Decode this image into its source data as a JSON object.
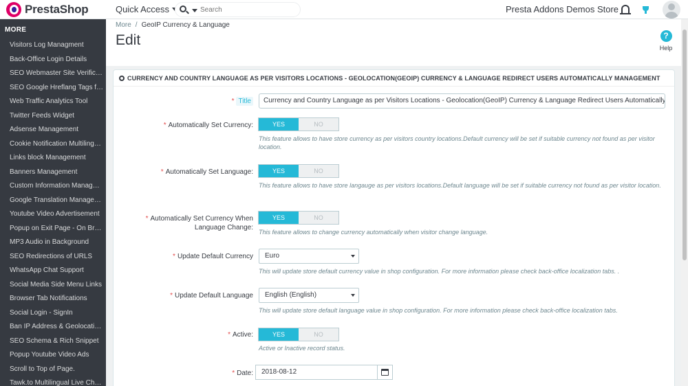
{
  "header": {
    "logo_text": "PrestaShop",
    "quick_access": "Quick Access",
    "search_placeholder": "Search",
    "store_name": "Presta Addons Demos Store"
  },
  "sidebar": {
    "heading": "MORE",
    "items": [
      "Visitors Log Managment",
      "Back-Office Login Details",
      "SEO Webmaster Site Verification",
      "SEO Google Hreflang Tags for Mul...",
      "Web Traffic Analytics Tool",
      "Twitter Feeds Widget",
      "Adsense Management",
      "Cookie Notification Multilingual",
      "Links block Management",
      "Banners Management",
      "Custom Information Managem...",
      "Google Translation Management",
      "Youtube Video Advertisement",
      "Popup on Exit Page - On Brows...",
      "MP3 Audio in Background",
      "SEO Redirections of URLS",
      "WhatsApp Chat Support",
      "Social Media Side Menu Links",
      "Browser Tab Notifications",
      "Social Login - SignIn",
      "Ban IP Address & Geolocation R...",
      "SEO Schema & Rich Snippet",
      "Popup Youtube Video Ads",
      "Scroll to Top of Page.",
      "Tawk.to Multilingual Live Chat S..."
    ]
  },
  "pagehead": {
    "breadcrumb_parent": "More",
    "breadcrumb_separator": "/",
    "breadcrumb_current": "GeoIP Currency & Language",
    "title": "Edit",
    "help_icon": "?",
    "help_label": "Help"
  },
  "panel": {
    "heading": "CURRENCY AND COUNTRY LANGUAGE AS PER VISITORS LOCATIONS - GEOLOCATION(GEOIP) CURRENCY & LANGUAGE REDIRECT USERS AUTOMATICALLY MANAGEMENT",
    "required_mark": "*",
    "yes_label": "YES",
    "no_label": "NO",
    "title_label": "Title",
    "title_value": "Currency and Country Language as per Visitors Locations - Geolocation(GeoIP) Currency & Language Redirect Users Automatically Manageme",
    "auto_currency_label": "Automatically Set Currency:",
    "auto_currency_help": "This feature allows to have store currency as per visitors country locations.Default currency will be set if suitable currency not found as per visitor location.",
    "auto_language_label": "Automatically Set Language:",
    "auto_language_help": "This feature allows to have store langauge as per visitors locations.Default language will be set if suitable currency not found as per visitor location.",
    "auto_currency_lang_label": "Automatically Set Currency When Language Change:",
    "auto_currency_lang_help": "This feature allows to change currency automatically when visitor change language.",
    "default_currency_label": "Update Default Currency",
    "default_currency_value": "Euro",
    "default_currency_help": "This will update store default currency value in shop configuration. For more information please check back-office localization tabs. .",
    "default_language_label": "Update Default Language",
    "default_language_value": "English (English)",
    "default_language_help": "This will update store default language value in shop configuration. For more information please check back-office localization tabs.",
    "active_label": "Active:",
    "active_help": "Active or Inactive record status.",
    "date_label": "Date:",
    "date_value": "2018-08-12"
  },
  "colors": {
    "accent": "#25b9d7",
    "sidebar_bg": "#363a41",
    "required": "#e34d4d"
  },
  "icons": [
    "search-icon",
    "bell-icon",
    "trophy-icon",
    "avatar",
    "help-icon",
    "cogs-icon",
    "calendar-icon"
  ]
}
